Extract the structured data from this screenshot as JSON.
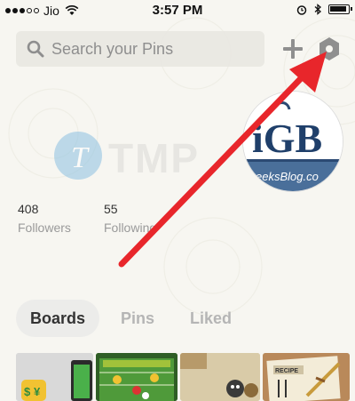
{
  "status_bar": {
    "carrier": "Jio",
    "time": "3:57 PM",
    "icons": [
      "signal-dots-icon",
      "wifi-icon",
      "alarm-icon",
      "bluetooth-icon",
      "battery-icon"
    ]
  },
  "search": {
    "placeholder": "Search your Pins"
  },
  "header_actions": {
    "add_icon": "plus-icon",
    "settings_icon": "hexagon-settings-icon"
  },
  "profile": {
    "watermark_text": "TMP",
    "photo_text_top": "iGB",
    "photo_text_bottom": "eeksBlog.co",
    "stats": [
      {
        "count": "408",
        "label": "Followers"
      },
      {
        "count": "55",
        "label": "Following"
      }
    ]
  },
  "annotation": {
    "type": "red-arrow",
    "color": "#e8262b",
    "points_to": "settings-button"
  },
  "tabs": [
    {
      "label": "Boards",
      "active": true
    },
    {
      "label": "Pins",
      "active": false
    },
    {
      "label": "Liked",
      "active": false
    }
  ],
  "thumbnail_text": {
    "recipe_label": "RECIPE"
  },
  "colors": {
    "background": "#f7f6f1",
    "accent_red": "#e8262b",
    "text_muted": "#9a9a9a"
  }
}
